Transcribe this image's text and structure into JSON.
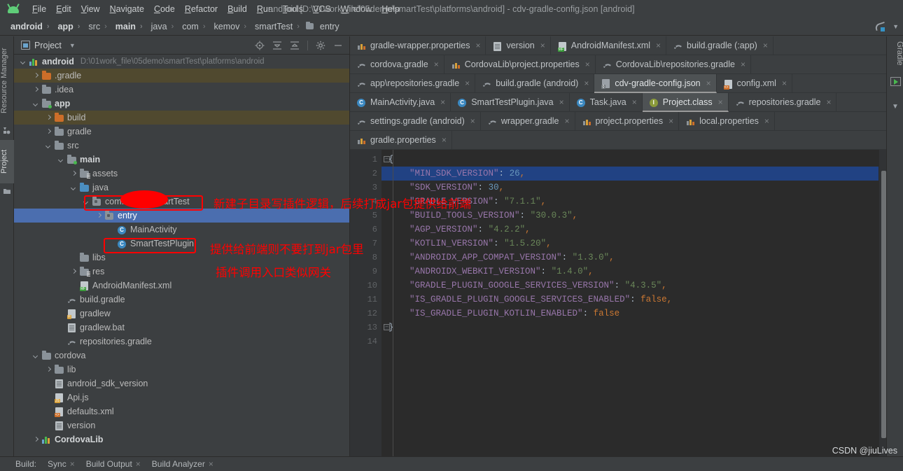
{
  "window": {
    "title": "android [D:\\01work_file\\05demo\\smartTest\\platforms\\android] - cdv-gradle-config.json [android]",
    "logo": "android-logo"
  },
  "menubar": {
    "items": [
      "File",
      "Edit",
      "View",
      "Navigate",
      "Code",
      "Refactor",
      "Build",
      "Run",
      "Tools",
      "VCS",
      "Window",
      "Help"
    ]
  },
  "breadcrumb": {
    "items": [
      {
        "label": "android",
        "bold": true
      },
      {
        "label": "app",
        "bold": true
      },
      {
        "label": "src",
        "bold": false
      },
      {
        "label": "main",
        "bold": true
      },
      {
        "label": "java",
        "bold": false
      },
      {
        "label": "com",
        "bold": false
      },
      {
        "label": "kemov",
        "bold": false
      },
      {
        "label": "smartTest",
        "bold": false
      },
      {
        "label": "entry",
        "bold": false,
        "icon": "folder-icon"
      }
    ],
    "separator": "›"
  },
  "left_strip": {
    "tabs": [
      {
        "label": "Resource Manager",
        "selected": false
      },
      {
        "label": "Project",
        "selected": true
      }
    ]
  },
  "project_panel": {
    "title": "Project",
    "dropdown_arrow": "chevron-down-icon",
    "toolbar_icons": [
      "locate-icon",
      "expand-all-icon",
      "collapse-all-icon",
      "settings-gear-icon",
      "hide-icon"
    ],
    "tree": [
      {
        "depth": 0,
        "arrow": "down",
        "icon": "module-icon",
        "label": "android",
        "bold": true,
        "sub": "D:\\01work_file\\05demo\\smartTest\\platforms\\android",
        "state": "none"
      },
      {
        "depth": 1,
        "arrow": "right",
        "icon": "folder-orange",
        "label": ".gradle",
        "bold": false,
        "sub": "",
        "state": "olive"
      },
      {
        "depth": 1,
        "arrow": "right",
        "icon": "folder-grey",
        "label": ".idea",
        "bold": false,
        "sub": "",
        "state": "none"
      },
      {
        "depth": 1,
        "arrow": "down",
        "icon": "module-folder",
        "label": "app",
        "bold": true,
        "sub": "",
        "state": "none"
      },
      {
        "depth": 2,
        "arrow": "right",
        "icon": "folder-orange",
        "label": "build",
        "bold": false,
        "sub": "",
        "state": "olive"
      },
      {
        "depth": 2,
        "arrow": "right",
        "icon": "folder-grey",
        "label": "gradle",
        "bold": false,
        "sub": "",
        "state": "none"
      },
      {
        "depth": 2,
        "arrow": "down",
        "icon": "folder-grey",
        "label": "src",
        "bold": false,
        "sub": "",
        "state": "none"
      },
      {
        "depth": 3,
        "arrow": "down",
        "icon": "module-folder",
        "label": "main",
        "bold": true,
        "sub": "",
        "state": "none"
      },
      {
        "depth": 4,
        "arrow": "right",
        "icon": "folder-res",
        "label": "assets",
        "bold": false,
        "sub": "",
        "state": "none"
      },
      {
        "depth": 4,
        "arrow": "down",
        "icon": "folder-blue",
        "label": "java",
        "bold": false,
        "sub": "",
        "state": "none"
      },
      {
        "depth": 5,
        "arrow": "down",
        "icon": "package-icon",
        "label": "com.kemov.smartTest",
        "bold": false,
        "sub": "",
        "state": "none"
      },
      {
        "depth": 6,
        "arrow": "right",
        "icon": "package-icon",
        "label": "entry",
        "bold": false,
        "sub": "",
        "state": "blue"
      },
      {
        "depth": 7,
        "arrow": "none",
        "icon": "class-icon",
        "label": "MainActivity",
        "bold": false,
        "sub": "",
        "state": "none"
      },
      {
        "depth": 7,
        "arrow": "none",
        "icon": "class-icon",
        "label": "SmartTestPlugin",
        "bold": false,
        "sub": "",
        "state": "none"
      },
      {
        "depth": 4,
        "arrow": "none",
        "icon": "folder-grey",
        "label": "libs",
        "bold": false,
        "sub": "",
        "state": "none"
      },
      {
        "depth": 4,
        "arrow": "right",
        "icon": "folder-res",
        "label": "res",
        "bold": false,
        "sub": "",
        "state": "none"
      },
      {
        "depth": 4,
        "arrow": "none",
        "icon": "manifest-icon",
        "label": "AndroidManifest.xml",
        "bold": false,
        "sub": "",
        "state": "none"
      },
      {
        "depth": 3,
        "arrow": "none",
        "icon": "gradle-icon",
        "label": "build.gradle",
        "bold": false,
        "sub": "",
        "state": "none"
      },
      {
        "depth": 3,
        "arrow": "none",
        "icon": "shell-icon",
        "label": "gradlew",
        "bold": false,
        "sub": "",
        "state": "none"
      },
      {
        "depth": 3,
        "arrow": "none",
        "icon": "file-icon",
        "label": "gradlew.bat",
        "bold": false,
        "sub": "",
        "state": "none"
      },
      {
        "depth": 3,
        "arrow": "none",
        "icon": "gradle-icon",
        "label": "repositories.gradle",
        "bold": false,
        "sub": "",
        "state": "none"
      },
      {
        "depth": 1,
        "arrow": "down",
        "icon": "folder-grey",
        "label": "cordova",
        "bold": false,
        "sub": "",
        "state": "none"
      },
      {
        "depth": 2,
        "arrow": "right",
        "icon": "folder-grey",
        "label": "lib",
        "bold": false,
        "sub": "",
        "state": "none"
      },
      {
        "depth": 2,
        "arrow": "none",
        "icon": "file-icon",
        "label": "android_sdk_version",
        "bold": false,
        "sub": "",
        "state": "none"
      },
      {
        "depth": 2,
        "arrow": "none",
        "icon": "js-icon",
        "label": "Api.js",
        "bold": false,
        "sub": "",
        "state": "none"
      },
      {
        "depth": 2,
        "arrow": "none",
        "icon": "xml-icon",
        "label": "defaults.xml",
        "bold": false,
        "sub": "",
        "state": "none"
      },
      {
        "depth": 2,
        "arrow": "none",
        "icon": "file-icon",
        "label": "version",
        "bold": false,
        "sub": "",
        "state": "none"
      },
      {
        "depth": 1,
        "arrow": "right",
        "icon": "module-icon",
        "label": "CordovaLib",
        "bold": true,
        "sub": "",
        "state": "none"
      }
    ]
  },
  "editor": {
    "tab_rows": [
      [
        {
          "label": "gradle-wrapper.properties",
          "icon": "properties-icon",
          "active": false,
          "close": "×"
        },
        {
          "label": "version",
          "icon": "file-icon",
          "active": false,
          "close": "×"
        },
        {
          "label": "AndroidManifest.xml",
          "icon": "manifest-icon",
          "active": false,
          "close": "×"
        },
        {
          "label": "build.gradle (:app)",
          "icon": "gradle-icon",
          "active": false,
          "close": "×"
        }
      ],
      [
        {
          "label": "cordova.gradle",
          "icon": "gradle-icon",
          "active": false,
          "close": "×"
        },
        {
          "label": "CordovaLib\\project.properties",
          "icon": "properties-icon",
          "active": false,
          "close": "×"
        },
        {
          "label": "CordovaLib\\repositories.gradle",
          "icon": "gradle-icon",
          "active": false,
          "close": "×"
        }
      ],
      [
        {
          "label": "app\\repositories.gradle",
          "icon": "gradle-icon",
          "active": false,
          "close": "×"
        },
        {
          "label": "build.gradle (android)",
          "icon": "gradle-icon",
          "active": false,
          "close": "×"
        },
        {
          "label": "cdv-gradle-config.json",
          "icon": "json-icon",
          "active": true,
          "close": "×"
        },
        {
          "label": "config.xml",
          "icon": "xml-icon",
          "active": false,
          "close": "×"
        }
      ],
      [
        {
          "label": "MainActivity.java",
          "icon": "class-icon",
          "active": false,
          "close": "×"
        },
        {
          "label": "SmartTestPlugin.java",
          "icon": "class-icon",
          "active": false,
          "close": "×"
        },
        {
          "label": "Task.java",
          "icon": "class-icon",
          "active": false,
          "close": "×"
        },
        {
          "label": "Project.class",
          "icon": "interface-icon",
          "active": true,
          "close": "×"
        },
        {
          "label": "repositories.gradle",
          "icon": "gradle-icon",
          "active": false,
          "close": "×"
        }
      ],
      [
        {
          "label": "settings.gradle (android)",
          "icon": "gradle-icon",
          "active": false,
          "close": "×"
        },
        {
          "label": "wrapper.gradle",
          "icon": "gradle-icon",
          "active": false,
          "close": "×"
        },
        {
          "label": "project.properties",
          "icon": "properties-icon",
          "active": false,
          "close": "×"
        },
        {
          "label": "local.properties",
          "icon": "properties-icon",
          "active": false,
          "close": "×"
        }
      ],
      [
        {
          "label": "gradle.properties",
          "icon": "properties-icon",
          "active": false,
          "close": "×"
        }
      ]
    ],
    "overflow_icon": "kebab-menu-icon",
    "inspection_status": "✔",
    "line_numbers": [
      "1",
      "2",
      "3",
      "4",
      "5",
      "6",
      "7",
      "8",
      "9",
      "10",
      "11",
      "12",
      "13",
      "14"
    ],
    "highlighted_line": 2,
    "code_lines": [
      {
        "n": 1,
        "indent": 0,
        "parts": [
          {
            "t": "{",
            "c": "brace"
          }
        ],
        "fold": "minus"
      },
      {
        "n": 2,
        "indent": 1,
        "parts": [
          {
            "t": "\"MIN_SDK_VERSION\"",
            "c": "k"
          },
          {
            "t": ": ",
            "c": "brace"
          },
          {
            "t": "26",
            "c": "n"
          },
          {
            "t": ",",
            "c": "p"
          }
        ],
        "hl": true
      },
      {
        "n": 3,
        "indent": 1,
        "parts": [
          {
            "t": "\"SDK_VERSION\"",
            "c": "k"
          },
          {
            "t": ": ",
            "c": "brace"
          },
          {
            "t": "30",
            "c": "n"
          },
          {
            "t": ",",
            "c": "p"
          }
        ]
      },
      {
        "n": 4,
        "indent": 1,
        "parts": [
          {
            "t": "\"GRADLE_VERSION\"",
            "c": "k"
          },
          {
            "t": ": ",
            "c": "brace"
          },
          {
            "t": "\"7.1.1\"",
            "c": "s"
          },
          {
            "t": ",",
            "c": "p"
          }
        ]
      },
      {
        "n": 5,
        "indent": 1,
        "parts": [
          {
            "t": "\"BUILD_TOOLS_VERSION\"",
            "c": "k"
          },
          {
            "t": ": ",
            "c": "brace"
          },
          {
            "t": "\"30.0.3\"",
            "c": "s"
          },
          {
            "t": ",",
            "c": "p"
          }
        ]
      },
      {
        "n": 6,
        "indent": 1,
        "parts": [
          {
            "t": "\"AGP_VERSION\"",
            "c": "k"
          },
          {
            "t": ": ",
            "c": "brace"
          },
          {
            "t": "\"4.2.2\"",
            "c": "s"
          },
          {
            "t": ",",
            "c": "p"
          }
        ]
      },
      {
        "n": 7,
        "indent": 1,
        "parts": [
          {
            "t": "\"KOTLIN_VERSION\"",
            "c": "k"
          },
          {
            "t": ": ",
            "c": "brace"
          },
          {
            "t": "\"1.5.20\"",
            "c": "s"
          },
          {
            "t": ",",
            "c": "p"
          }
        ]
      },
      {
        "n": 8,
        "indent": 1,
        "parts": [
          {
            "t": "\"ANDROIDX_APP_COMPAT_VERSION\"",
            "c": "k"
          },
          {
            "t": ": ",
            "c": "brace"
          },
          {
            "t": "\"1.3.0\"",
            "c": "s"
          },
          {
            "t": ",",
            "c": "p"
          }
        ]
      },
      {
        "n": 9,
        "indent": 1,
        "parts": [
          {
            "t": "\"ANDROIDX_WEBKIT_VERSION\"",
            "c": "k"
          },
          {
            "t": ": ",
            "c": "brace"
          },
          {
            "t": "\"1.4.0\"",
            "c": "s"
          },
          {
            "t": ",",
            "c": "p"
          }
        ]
      },
      {
        "n": 10,
        "indent": 1,
        "parts": [
          {
            "t": "\"GRADLE_PLUGIN_GOOGLE_SERVICES_VERSION\"",
            "c": "k"
          },
          {
            "t": ": ",
            "c": "brace"
          },
          {
            "t": "\"4.3.5\"",
            "c": "s"
          },
          {
            "t": ",",
            "c": "p"
          }
        ]
      },
      {
        "n": 11,
        "indent": 1,
        "parts": [
          {
            "t": "\"IS_GRADLE_PLUGIN_GOOGLE_SERVICES_ENABLED\"",
            "c": "k"
          },
          {
            "t": ": ",
            "c": "brace"
          },
          {
            "t": "false",
            "c": "b"
          },
          {
            "t": ",",
            "c": "p"
          }
        ]
      },
      {
        "n": 12,
        "indent": 1,
        "parts": [
          {
            "t": "\"IS_GRADLE_PLUGIN_KOTLIN_ENABLED\"",
            "c": "k"
          },
          {
            "t": ": ",
            "c": "brace"
          },
          {
            "t": "false",
            "c": "b"
          }
        ]
      },
      {
        "n": 13,
        "indent": 0,
        "parts": [
          {
            "t": "}",
            "c": "brace"
          }
        ],
        "fold": "minus"
      },
      {
        "n": 14,
        "indent": 0,
        "parts": []
      }
    ]
  },
  "right_strip": {
    "label": "Gradle",
    "buttons": [
      "run-gradle-icon",
      "chevron-down-icon"
    ]
  },
  "statusbar": {
    "prefix": "Build:",
    "items": [
      {
        "label": "Sync",
        "close": "×"
      },
      {
        "label": "Build Output",
        "close": "×"
      },
      {
        "label": "Build Analyzer",
        "close": "×"
      }
    ]
  },
  "watermark": "CSDN @jiuLives",
  "annotations": [
    {
      "id": "anno-1",
      "text": "新建子目录写插件逻辑，后续打成jar包提供给前端"
    },
    {
      "id": "anno-2",
      "text": "提供给前端则不要打到jar包里"
    },
    {
      "id": "anno-3",
      "text": "插件调用入口类似网关"
    }
  ],
  "colors": {
    "accent_selection": "#4b6eaf",
    "annotation_red": "#ff0000",
    "editor_bg": "#2b2b2b",
    "panel_bg": "#3c3f41",
    "code_string": "#6a8759",
    "code_key": "#9876aa",
    "code_number": "#6897bb",
    "code_bool": "#cc7832"
  }
}
